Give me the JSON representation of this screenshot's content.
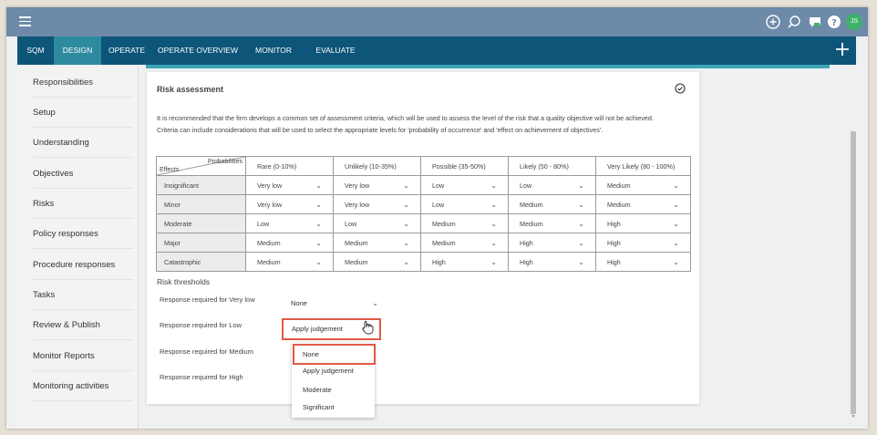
{
  "topbar": {
    "icons": [
      "menu-icon",
      "add-circle-icon",
      "search-icon",
      "chat-icon",
      "help-icon"
    ],
    "avatar_initials": "JS"
  },
  "nav": {
    "items": [
      "SQM",
      "DESIGN",
      "OPERATE",
      "OPERATE OVERVIEW",
      "MONITOR",
      "EVALUATE"
    ],
    "active": "DESIGN"
  },
  "sidebar": {
    "items": [
      "Responsibilities",
      "Setup",
      "Understanding",
      "Objectives",
      "Risks",
      "Policy responses",
      "Procedure responses",
      "Tasks",
      "Review & Publish",
      "Monitor Reports",
      "Monitoring activities"
    ]
  },
  "card": {
    "title": "Risk assessment",
    "description_1": "It is recommended that the firm develops a common set of assessment criteria, which will be used to assess the level of the risk that a quality objective will not be achieved.",
    "description_2": "Criteria can include considerations that will be used to select the appropriate levels for 'probability of occurrence' and 'effect on achievement of objectives'."
  },
  "matrix": {
    "corner_probabilities": "Probabilities",
    "corner_effects": "Effects",
    "columns": [
      "Rare (0-10%)",
      "Unlikely (10-35%)",
      "Possible (35-50%)",
      "Likely (50 - 80%)",
      "Very Likely (80 - 100%)"
    ],
    "rows": [
      {
        "effect": "Insignificant",
        "values": [
          "Very low",
          "Very low",
          "Low",
          "Low",
          "Medium"
        ]
      },
      {
        "effect": "Minor",
        "values": [
          "Very low",
          "Very low",
          "Low",
          "Medium",
          "Medium"
        ]
      },
      {
        "effect": "Moderate",
        "values": [
          "Low",
          "Low",
          "Medium",
          "Medium",
          "High"
        ]
      },
      {
        "effect": "Major",
        "values": [
          "Medium",
          "Medium",
          "Medium",
          "High",
          "High"
        ]
      },
      {
        "effect": "Catastrophic",
        "values": [
          "Medium",
          "Medium",
          "High",
          "High",
          "High"
        ]
      }
    ]
  },
  "thresholds": {
    "title": "Risk thresholds",
    "very_low_label": "Response required for Very low",
    "very_low_value": "None",
    "low_label": "Response required for Low",
    "low_value": "Apply judgement",
    "medium_label": "Response required for Medium",
    "high_label": "Response required for High"
  },
  "dropdown": {
    "options": [
      "None",
      "Apply judgement",
      "Moderate",
      "Significant"
    ],
    "highlighted": "None"
  }
}
